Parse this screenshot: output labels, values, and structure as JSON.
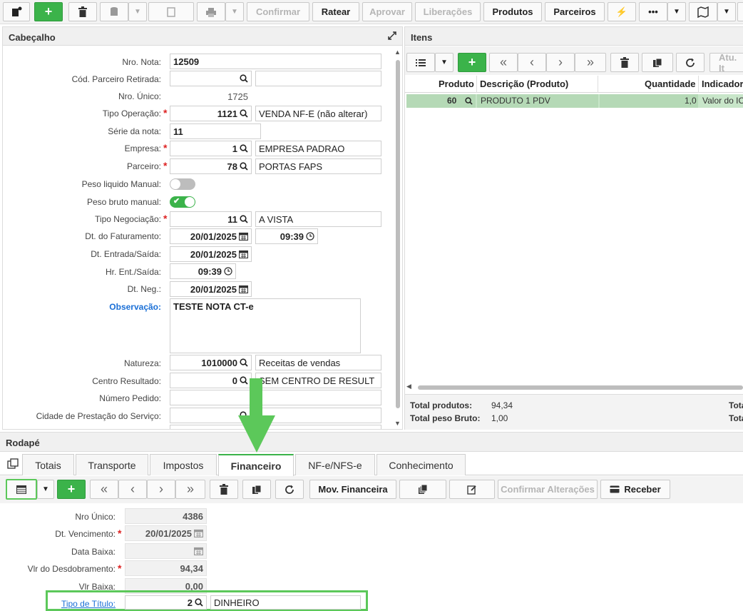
{
  "toolbar": {
    "confirmar": "Confirmar",
    "ratear": "Ratear",
    "aprovar": "Aprovar",
    "liberacoes": "Liberações",
    "produtos": "Produtos",
    "parceiros": "Parceiros"
  },
  "header": {
    "title": "Cabeçalho",
    "labels": {
      "nro_nota": "Nro. Nota:",
      "cod_parceiro": "Cód. Parceiro Retirada:",
      "nro_unico": "Nro. Único:",
      "tipo_operacao": "Tipo Operação:",
      "serie": "Série da nota:",
      "empresa": "Empresa:",
      "parceiro": "Parceiro:",
      "peso_liquido": "Peso liquido Manual:",
      "peso_bruto": "Peso bruto manual:",
      "tipo_negociacao": "Tipo Negociação:",
      "dt_faturamento": "Dt. do Faturamento:",
      "dt_entrada": "Dt. Entrada/Saída:",
      "hr_entrada": "Hr. Ent./Saída:",
      "dt_neg": "Dt. Neg.:",
      "observacao": "Observação:",
      "natureza": "Natureza:",
      "centro_resultado": "Centro Resultado:",
      "numero_pedido": "Número Pedido:",
      "cidade_prestacao": "Cidade de Prestação do Serviço:"
    },
    "values": {
      "nro_nota": "12509",
      "nro_unico": "1725",
      "tipo_operacao_code": "1121",
      "tipo_operacao_desc": "VENDA NF-E (não alterar)",
      "serie": "11",
      "empresa_code": "1",
      "empresa_desc": "EMPRESA PADRAO",
      "parceiro_code": "78",
      "parceiro_desc": "PORTAS FAPS",
      "peso_liquido_on": false,
      "peso_bruto_on": true,
      "tipo_negociacao_code": "11",
      "tipo_negociacao_desc": "A VISTA",
      "dt_faturamento": "20/01/2025",
      "hr_faturamento": "09:39",
      "dt_entrada": "20/01/2025",
      "hr_entrada": "09:39",
      "dt_neg": "20/01/2025",
      "observacao": "TESTE NOTA CT-e",
      "natureza_code": "1010000",
      "natureza_desc": "Receitas de vendas",
      "centro_resultado_code": "0",
      "centro_resultado_desc": "SEM CENTRO DE RESULT"
    }
  },
  "items": {
    "title": "Itens",
    "atu_label": "Atu. It",
    "columns": [
      "Produto",
      "Descrição (Produto)",
      "Quantidade",
      "Indicador"
    ],
    "rows": [
      {
        "produto": "60",
        "descricao": "PRODUTO 1 PDV",
        "quantidade": "1,0",
        "indicador": "Valor do IC"
      }
    ],
    "totals": {
      "produtos_label": "Total produtos:",
      "produtos_value": "94,34",
      "peso_label": "Total peso Bruto:",
      "peso_value": "1,00",
      "right1": "Tota",
      "right2": "Tota"
    }
  },
  "footer": {
    "title": "Rodapé",
    "tabs": [
      "Totais",
      "Transporte",
      "Impostos",
      "Financeiro",
      "NF-e/NFS-e",
      "Conhecimento"
    ],
    "active_tab": "Financeiro",
    "toolbar": {
      "mov_financeira": "Mov. Financeira",
      "confirmar_alteracoes": "Confirmar Alterações",
      "receber": "Receber"
    },
    "labels": {
      "nro_unico": "Nro Único:",
      "dt_vencimento": "Dt. Vencimento:",
      "data_baixa": "Data Baixa:",
      "vlr_desdobramento": "Vlr do Desdobramento:",
      "vlr_baixa": "Vlr Baixa:",
      "tipo_titulo": "Tipo de Título:"
    },
    "values": {
      "nro_unico": "4386",
      "dt_vencimento": "20/01/2025",
      "data_baixa": "",
      "vlr_desdobramento": "94,34",
      "vlr_baixa": "0,00",
      "tipo_titulo_code": "2",
      "tipo_titulo_desc": "DINHEIRO"
    }
  },
  "colors": {
    "accent_green": "#3bb34a",
    "highlight_green": "#5cc85a",
    "link_blue": "#1a6fd6",
    "required_red": "#d22222",
    "row_selected": "#c8e6c9"
  }
}
